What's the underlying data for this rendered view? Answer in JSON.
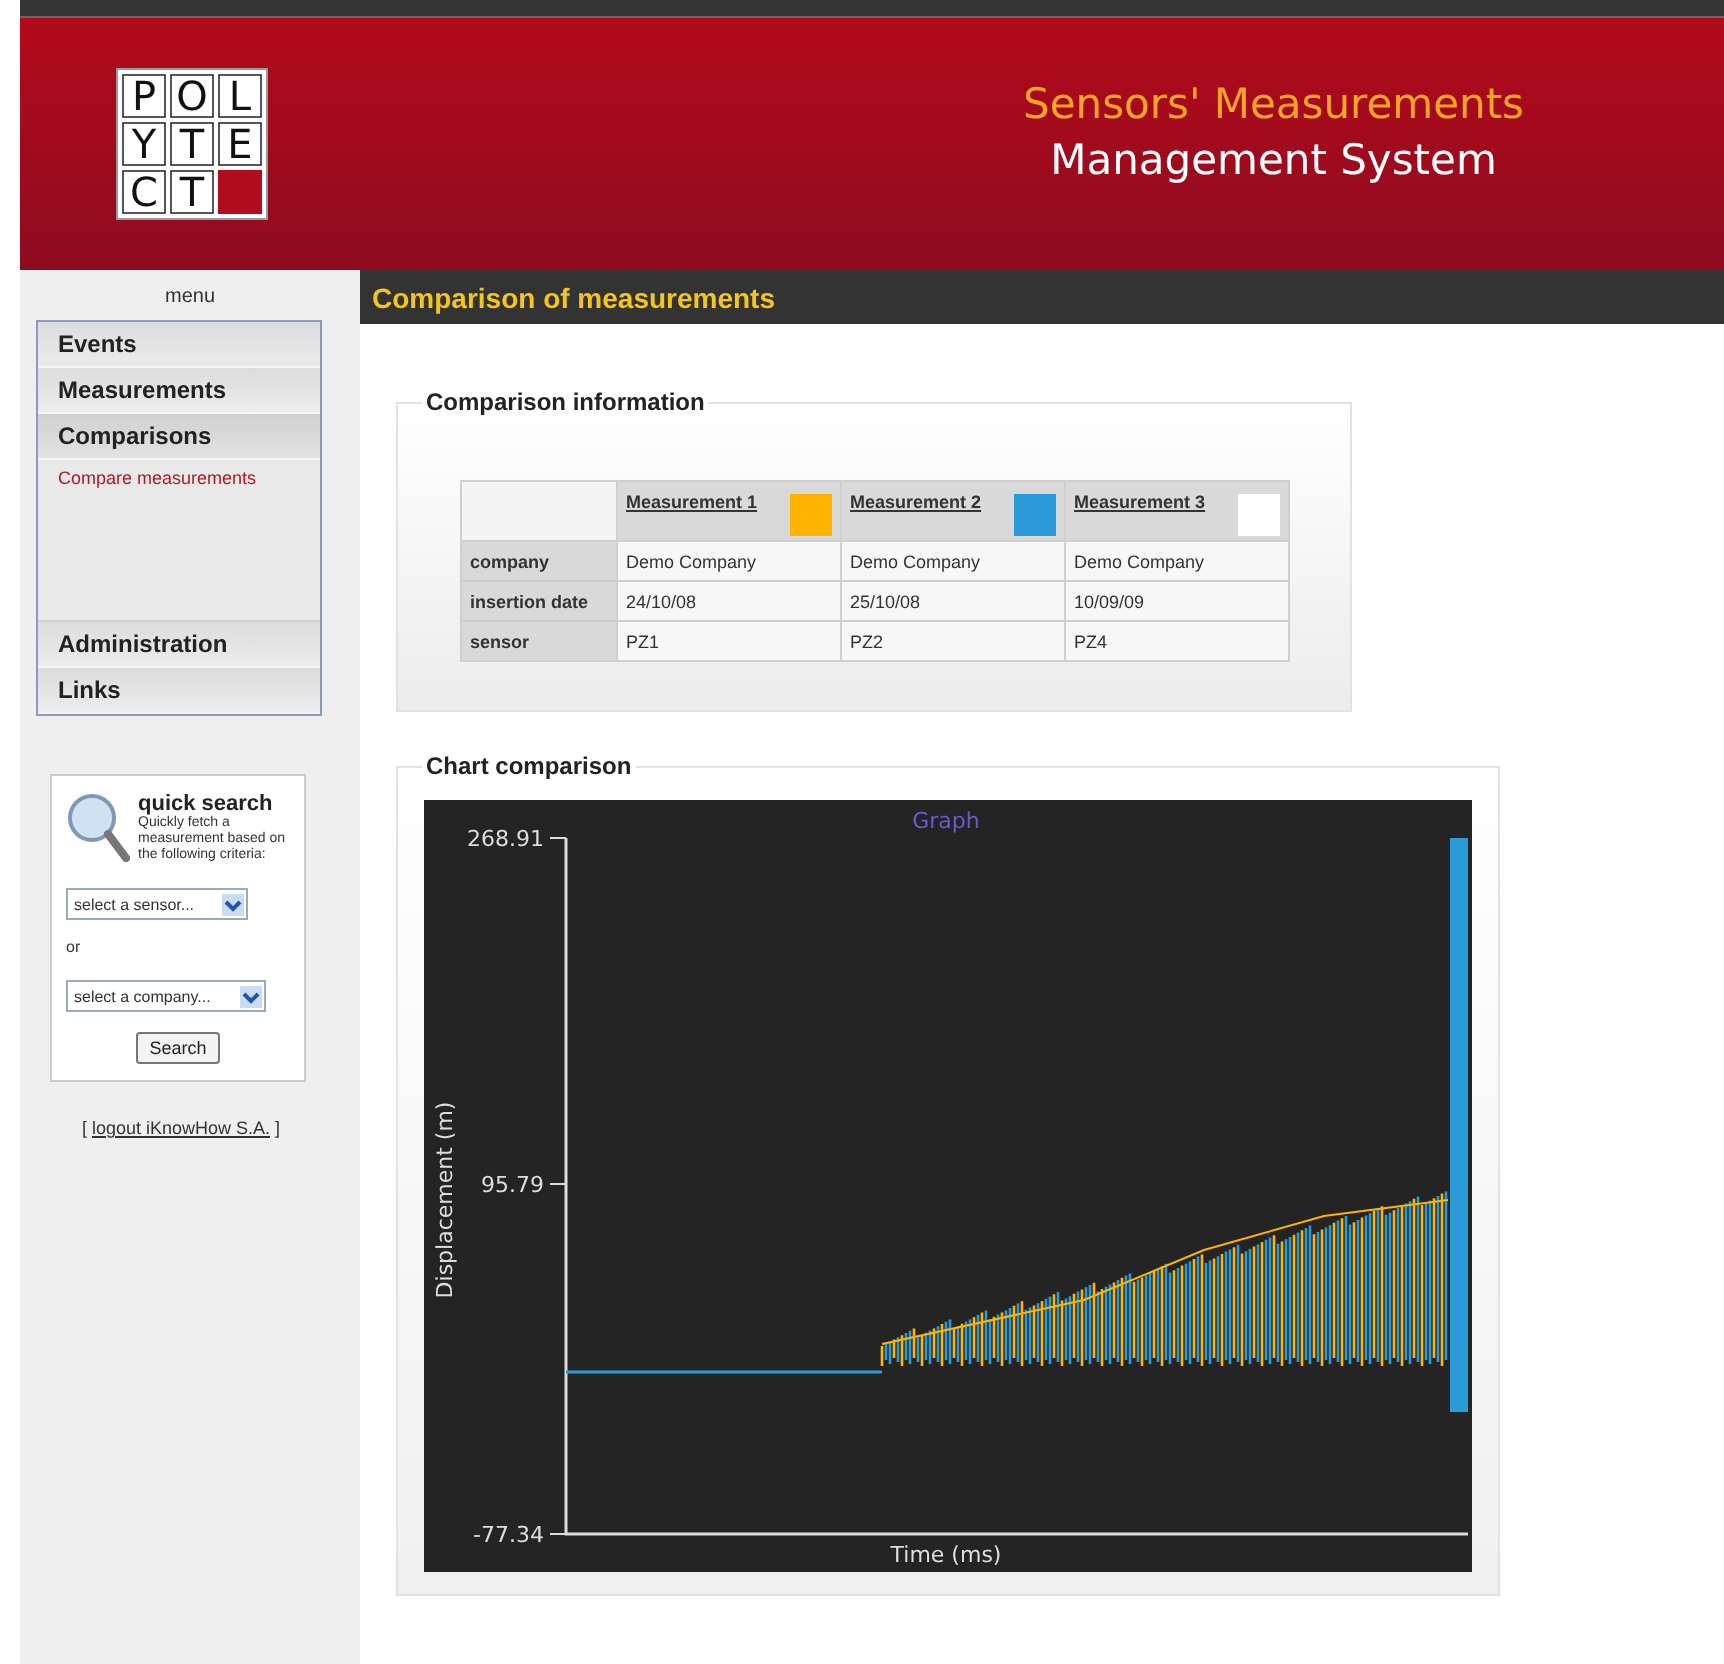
{
  "header": {
    "logo_letters": [
      "P",
      "O",
      "L",
      "Y",
      "T",
      "E",
      "C",
      "T"
    ],
    "title_line_1": "Sensors' Measurements",
    "title_line_2": "Management System"
  },
  "page_title": "Comparison of measurements",
  "sidebar": {
    "menu_label": "menu",
    "menu_items": [
      {
        "label": "Events",
        "expanded": false
      },
      {
        "label": "Measurements",
        "expanded": false
      },
      {
        "label": "Comparisons",
        "expanded": true,
        "children": [
          {
            "label": "Compare measurements"
          }
        ]
      },
      {
        "label": "Administration",
        "expanded": false
      },
      {
        "label": "Links",
        "expanded": false
      }
    ],
    "quick_search": {
      "title": "quick search",
      "description": "Quickly fetch a measurement based on the following criteria:",
      "sensor_select": "select a sensor...",
      "or_label": "or",
      "company_select": "select a company...",
      "button": "Search"
    },
    "logout": {
      "prefix": "[",
      "link": "logout iKnowHow S.A.",
      "suffix": "]"
    }
  },
  "comparison_info": {
    "heading": "Comparison information",
    "measurements": [
      {
        "label": "Measurement 1",
        "color": "#ffb400"
      },
      {
        "label": "Measurement 2",
        "color": "#2a9bd8"
      },
      {
        "label": "Measurement 3",
        "color": "#ffffff"
      }
    ],
    "rows": [
      {
        "label": "company",
        "values": [
          "Demo Company",
          "Demo Company",
          "Demo Company"
        ]
      },
      {
        "label": "insertion date",
        "values": [
          "24/10/08",
          "25/10/08",
          "10/09/09"
        ]
      },
      {
        "label": "sensor",
        "values": [
          "PZ1",
          "PZ2",
          "PZ4"
        ]
      }
    ]
  },
  "chart_panel": {
    "heading": "Chart comparison",
    "chart": {
      "title": "Graph",
      "xlabel": "Time (ms)",
      "ylabel": "Displacement (m)",
      "ytick_labels": [
        "268.91",
        "95.79",
        "-77.34"
      ]
    }
  }
}
